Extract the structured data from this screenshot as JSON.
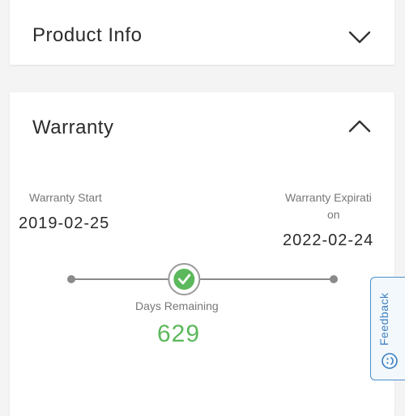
{
  "product_info": {
    "title": "Product Info",
    "toggle_icon": "chevron-down-icon"
  },
  "warranty": {
    "title": "Warranty",
    "toggle_icon": "chevron-up-icon",
    "start_label": "Warranty Start",
    "start_date": "2019-02-25",
    "expiration_label": "Warranty Expirati",
    "expiration_label_cont": "on",
    "expiration_date": "2022-02-24",
    "days_remaining_label": "Days Remaining",
    "days_remaining_value": "629",
    "status_icon": "check-circle-icon",
    "elapsed_fraction": 0.43
  },
  "feedback": {
    "label": "Feedback",
    "icon": "smiley-icon"
  },
  "colors": {
    "accent_green": "#5cb85c",
    "feedback_blue": "#3b7fc0",
    "timeline_gray": "#8a8a8a"
  }
}
